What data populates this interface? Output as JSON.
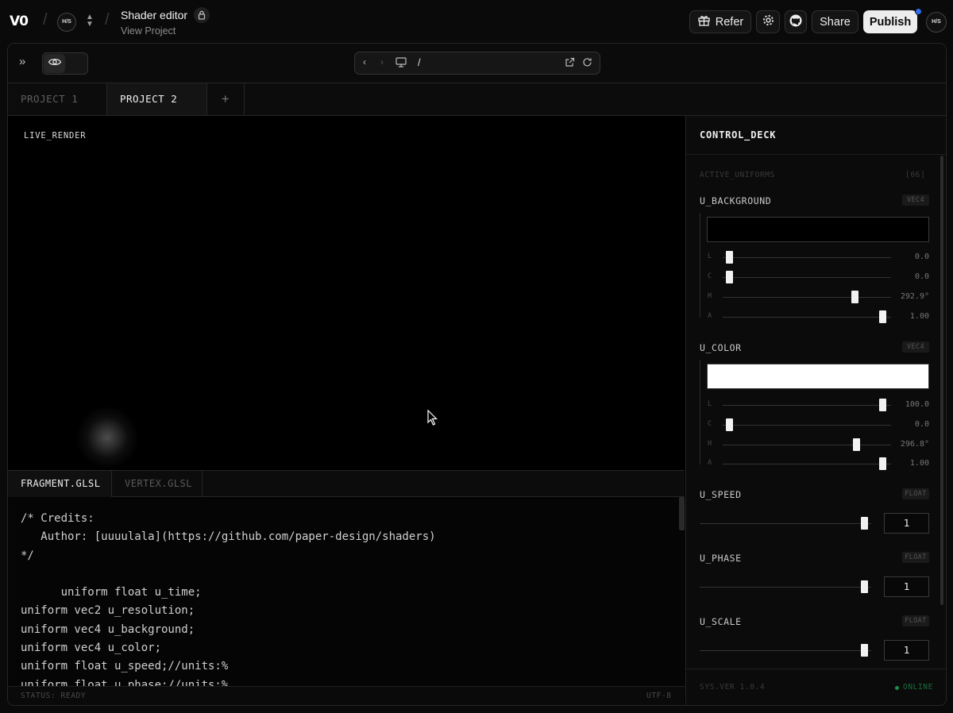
{
  "header": {
    "logo": "V0",
    "team_avatar": "H/S",
    "project_title": "Shader editor",
    "project_subtitle": "View Project",
    "refer_label": "Refer",
    "share_label": "Share",
    "publish_label": "Publish",
    "user_avatar": "H/S"
  },
  "toolbar": {
    "url_path": "/"
  },
  "project_tabs": [
    {
      "label": "PROJECT 1",
      "active": false
    },
    {
      "label": "PROJECT 2",
      "active": true
    }
  ],
  "project_tabs_add": "+",
  "render": {
    "label": "LIVE_RENDER"
  },
  "code_tabs": [
    {
      "label": "FRAGMENT.GLSL",
      "active": true
    },
    {
      "label": "VERTEX.GLSL",
      "active": false
    }
  ],
  "code": {
    "lines": [
      "/* Credits:",
      "   Author: [uuuulala](https://github.com/paper-design/shaders)",
      "*/",
      "",
      "      uniform float u_time;",
      "uniform vec2 u_resolution;",
      "uniform vec4 u_background;",
      "uniform vec4 u_color;",
      "uniform float u_speed;//units:%",
      "uniform float u_phase;//units:%"
    ]
  },
  "status": {
    "left": "STATUS: READY",
    "right": "UTF-8"
  },
  "control_deck": {
    "title": "CONTROL_DECK",
    "section_label": "ACTIVE_UNIFORMS",
    "section_count": "[06]",
    "uniforms": {
      "u_background": {
        "name": "U_BACKGROUND",
        "type": "VEC4",
        "swatch_color": "#000000",
        "channels": [
          {
            "label": "L",
            "value": "0.0",
            "fraction": 0.02
          },
          {
            "label": "C",
            "value": "0.0",
            "fraction": 0.02
          },
          {
            "label": "H",
            "value": "292.9°",
            "fraction": 0.8
          },
          {
            "label": "A",
            "value": "1.00",
            "fraction": 0.97
          }
        ]
      },
      "u_color": {
        "name": "U_COLOR",
        "type": "VEC4",
        "swatch_color": "#ffffff",
        "channels": [
          {
            "label": "L",
            "value": "100.0",
            "fraction": 0.97
          },
          {
            "label": "C",
            "value": "0.0",
            "fraction": 0.02
          },
          {
            "label": "H",
            "value": "296.8°",
            "fraction": 0.81
          },
          {
            "label": "A",
            "value": "1.00",
            "fraction": 0.97
          }
        ]
      },
      "u_speed": {
        "name": "U_SPEED",
        "type": "FLOAT",
        "value": "1",
        "fraction": 0.98
      },
      "u_phase": {
        "name": "U_PHASE",
        "type": "FLOAT",
        "value": "1",
        "fraction": 0.98
      },
      "u_scale": {
        "name": "U_SCALE",
        "type": "FLOAT",
        "value": "1",
        "fraction": 0.98
      }
    },
    "footer_version": "SYS.VER 1.0.4",
    "footer_status": "ONLINE"
  },
  "colors": {
    "accent_dot": "#2f6fed",
    "online": "#1f8a4a"
  }
}
